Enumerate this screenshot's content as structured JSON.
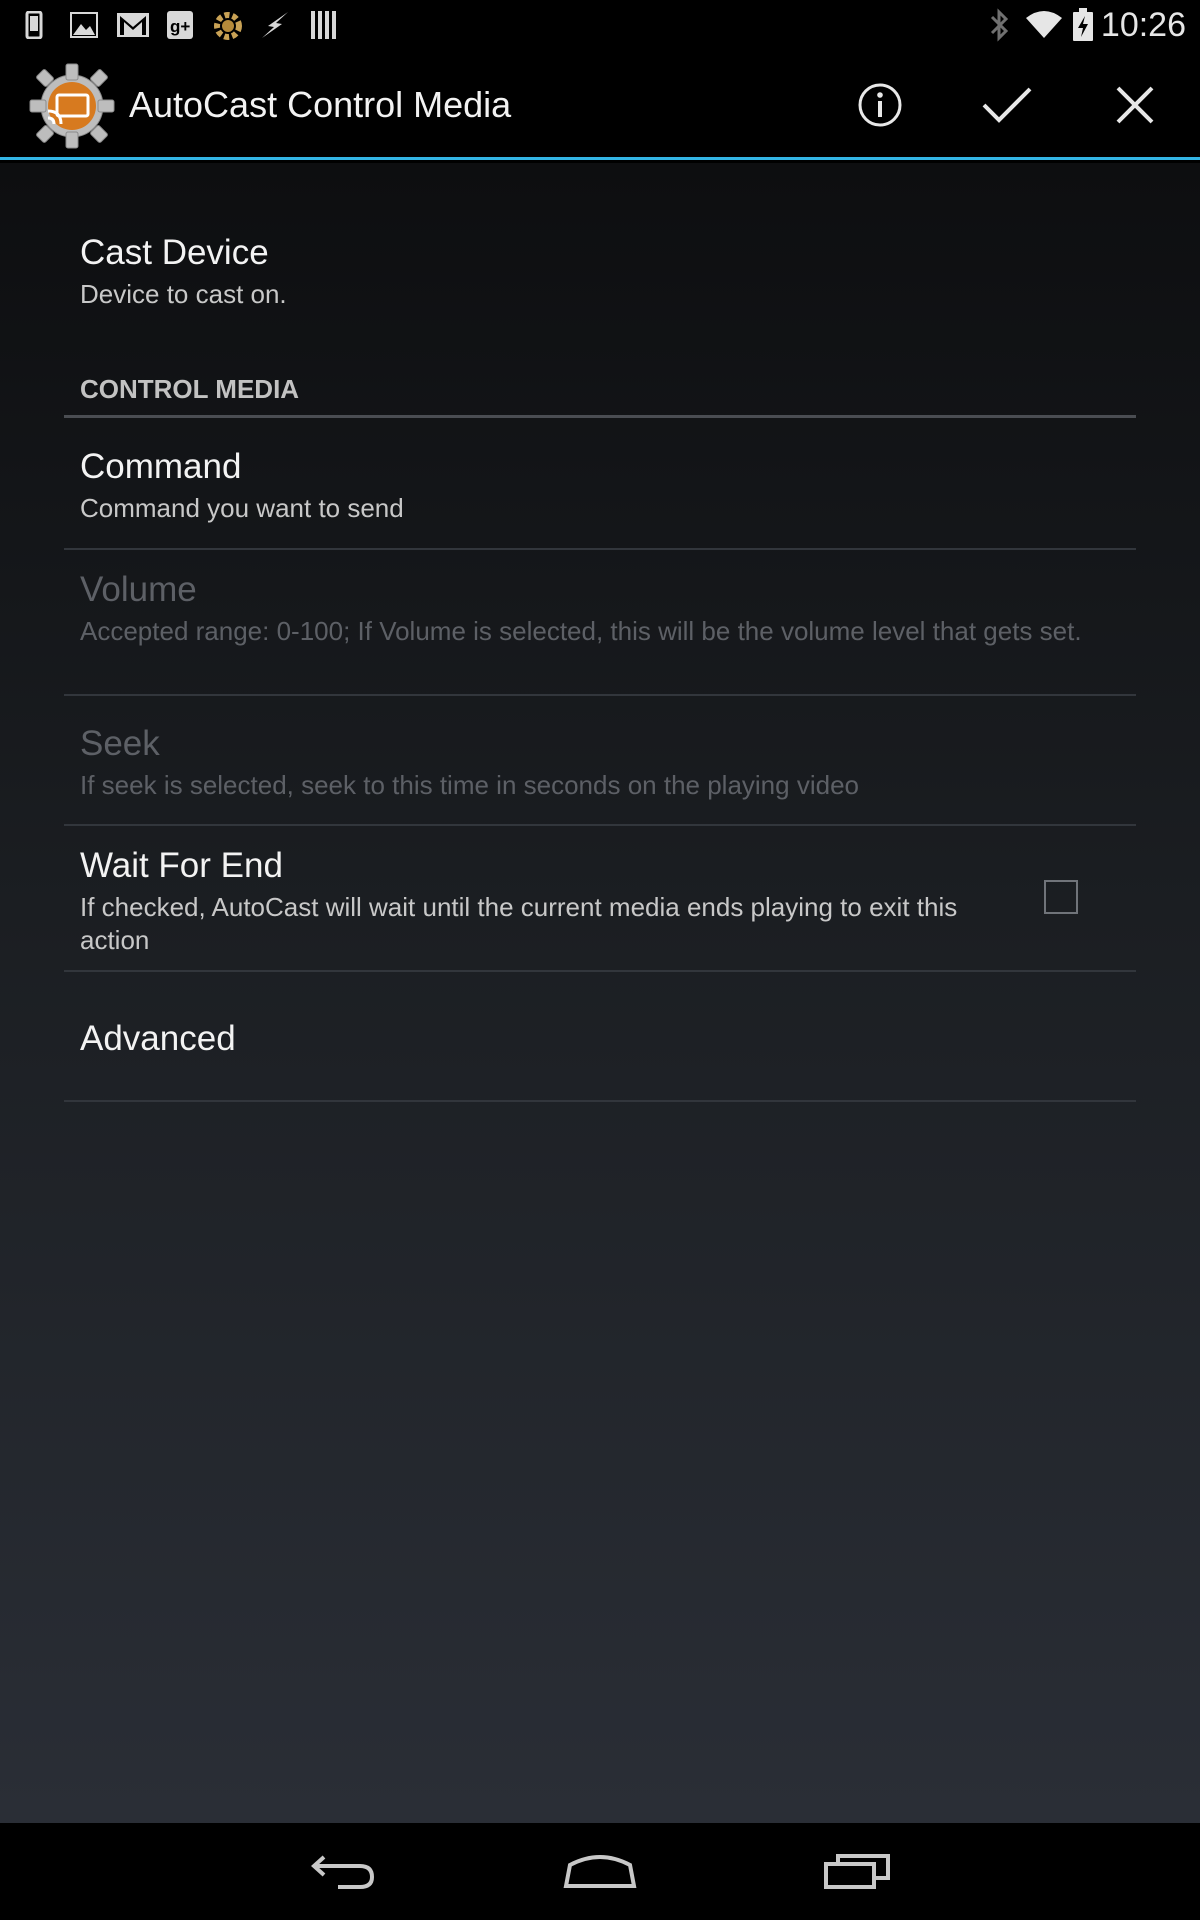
{
  "status_bar": {
    "time": "10:26",
    "left_icons": [
      "phone-icon",
      "image-icon",
      "gmail-icon",
      "google-plus-icon",
      "tasker-icon",
      "flash-icon",
      "barcode-icon"
    ],
    "right_icons": [
      "bluetooth-icon",
      "wifi-icon",
      "battery-charging-icon"
    ]
  },
  "action_bar": {
    "title": "AutoCast Control Media",
    "actions": [
      "info-icon",
      "check-icon",
      "close-icon"
    ],
    "accent_color": "#33b5e5"
  },
  "preferences": {
    "cast_device": {
      "title": "Cast Device",
      "summary": "Device to cast on."
    },
    "category": "CONTROL MEDIA",
    "command": {
      "title": "Command",
      "summary": "Command you want to send"
    },
    "volume": {
      "title": "Volume",
      "summary": "Accepted range: 0-100; If Volume is selected, this will be the volume level that gets set.",
      "enabled": false
    },
    "seek": {
      "title": "Seek",
      "summary": "If seek is selected, seek to this time in seconds on the playing video",
      "enabled": false
    },
    "wait_for_end": {
      "title": "Wait For End",
      "summary": "If checked, AutoCast will wait until the current media ends playing to exit this action",
      "checked": false
    },
    "advanced": {
      "title": "Advanced"
    }
  },
  "nav_bar": {
    "buttons": [
      "back-icon",
      "home-icon",
      "recents-icon"
    ]
  }
}
